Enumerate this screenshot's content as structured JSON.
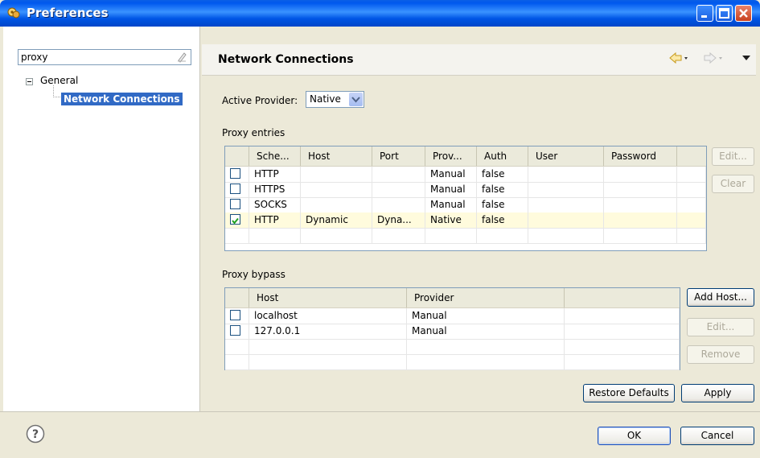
{
  "window": {
    "title": "Preferences"
  },
  "filter": {
    "value": "proxy"
  },
  "tree": {
    "general": "General",
    "selected": "Network Connections"
  },
  "page": {
    "title": "Network Connections"
  },
  "active_provider": {
    "label": "Active Provider:",
    "value": "Native"
  },
  "proxy_entries": {
    "label": "Proxy entries",
    "columns": [
      "Sche...",
      "Host",
      "Port",
      "Prov...",
      "Auth",
      "User",
      "Password"
    ],
    "rows": [
      {
        "checked": false,
        "scheme": "HTTP",
        "host": "",
        "port": "",
        "provider": "Manual",
        "auth": "false",
        "user": "",
        "password": ""
      },
      {
        "checked": false,
        "scheme": "HTTPS",
        "host": "",
        "port": "",
        "provider": "Manual",
        "auth": "false",
        "user": "",
        "password": ""
      },
      {
        "checked": false,
        "scheme": "SOCKS",
        "host": "",
        "port": "",
        "provider": "Manual",
        "auth": "false",
        "user": "",
        "password": ""
      },
      {
        "checked": true,
        "scheme": "HTTP",
        "host": "Dynamic",
        "port": "Dyna...",
        "provider": "Native",
        "auth": "false",
        "user": "",
        "password": ""
      }
    ],
    "buttons": {
      "edit": "Edit...",
      "clear": "Clear"
    }
  },
  "proxy_bypass": {
    "label": "Proxy bypass",
    "columns": [
      "Host",
      "Provider"
    ],
    "rows": [
      {
        "checked": false,
        "host": "localhost",
        "provider": "Manual"
      },
      {
        "checked": false,
        "host": "127.0.0.1",
        "provider": "Manual"
      }
    ],
    "buttons": {
      "add_host": "Add Host...",
      "edit": "Edit...",
      "remove": "Remove"
    }
  },
  "actions": {
    "restore_defaults": "Restore Defaults",
    "apply": "Apply",
    "ok": "OK",
    "cancel": "Cancel"
  },
  "colors": {
    "titlebar": "#0058EE",
    "selection": "#316AC5",
    "check": "#21A121"
  }
}
